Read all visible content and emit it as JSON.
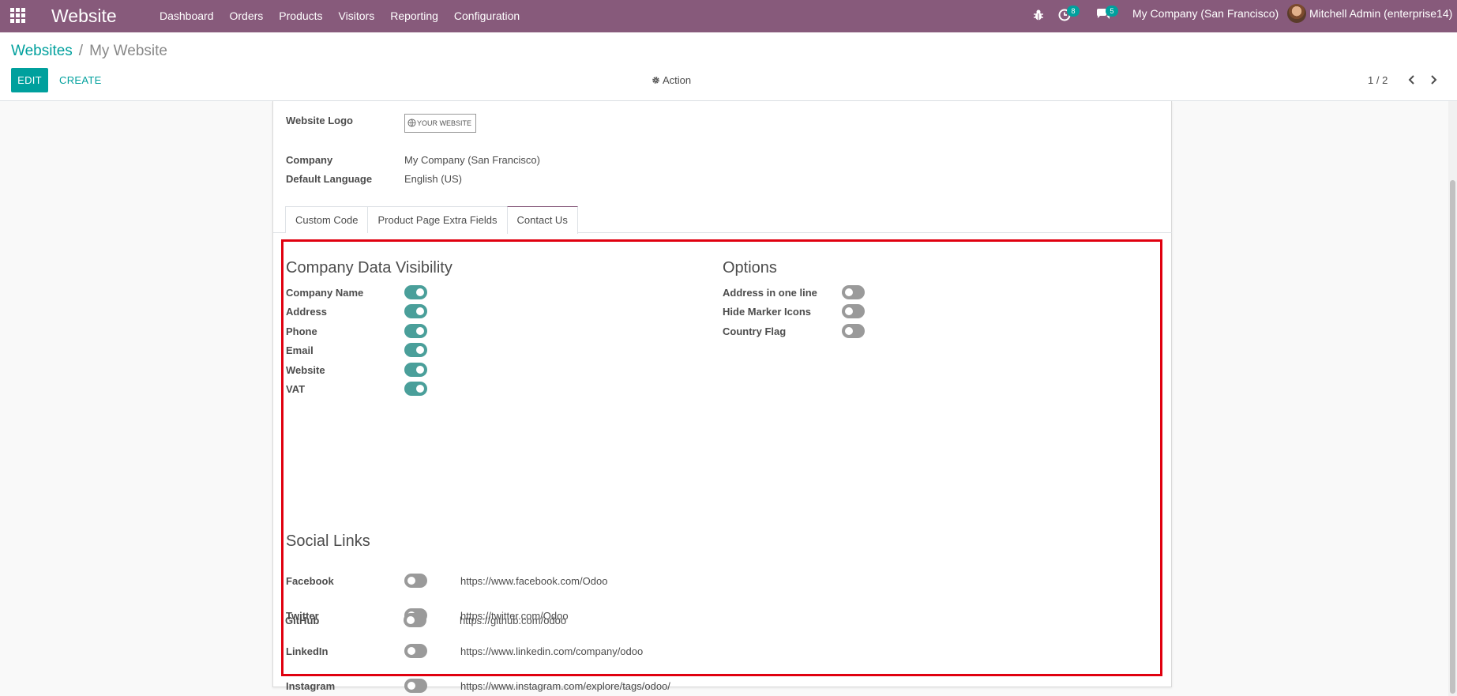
{
  "navbar": {
    "brand": "Website",
    "menu": [
      "Dashboard",
      "Orders",
      "Products",
      "Visitors",
      "Reporting",
      "Configuration"
    ],
    "activity_count": "8",
    "message_count": "5",
    "company": "My Company (San Francisco)",
    "user": "Mitchell Admin (enterprise14)"
  },
  "breadcrumb": {
    "parent": "Websites",
    "separator": "/",
    "current": "My Website"
  },
  "toolbar": {
    "edit_label": "EDIT",
    "create_label": "CREATE",
    "action_label": "Action",
    "pager": "1 / 2"
  },
  "form": {
    "logo_label": "Website Logo",
    "logo_text": "YOUR WEBSITE",
    "company_label": "Company",
    "company_value": "My Company (San Francisco)",
    "language_label": "Default Language",
    "language_value": "English (US)"
  },
  "tabs": [
    "Custom Code",
    "Product Page Extra Fields",
    "Contact Us"
  ],
  "active_tab": "Contact Us",
  "visibility": {
    "title": "Company Data Visibility",
    "items": [
      {
        "label": "Company Name",
        "on": true
      },
      {
        "label": "Address",
        "on": true
      },
      {
        "label": "Phone",
        "on": true
      },
      {
        "label": "Email",
        "on": true
      },
      {
        "label": "Website",
        "on": true
      },
      {
        "label": "VAT",
        "on": true
      }
    ]
  },
  "options": {
    "title": "Options",
    "items": [
      {
        "label": "Address in one line",
        "on": false
      },
      {
        "label": "Hide Marker Icons",
        "on": false
      },
      {
        "label": "Country Flag",
        "on": false
      }
    ]
  },
  "social": {
    "title": "Social Links",
    "items": [
      {
        "label": "Facebook",
        "on": false,
        "url": "https://www.facebook.com/Odoo"
      },
      {
        "label": "Twitter",
        "on": false,
        "url": "https://twitter.com/Odoo"
      },
      {
        "label": "LinkedIn",
        "on": false,
        "url": "https://www.linkedin.com/company/odoo"
      },
      {
        "label": "Instagram",
        "on": false,
        "url": "https://www.instagram.com/explore/tags/odoo/"
      },
      {
        "label": "GitHub",
        "on": false,
        "url": "https://github.com/odoo"
      }
    ]
  },
  "colors": {
    "navbar": "#875a7b",
    "primary": "#00a09d",
    "toggle_on": "#4a9f9a",
    "toggle_off": "#9a9a9a",
    "highlight": "#e0000f"
  }
}
